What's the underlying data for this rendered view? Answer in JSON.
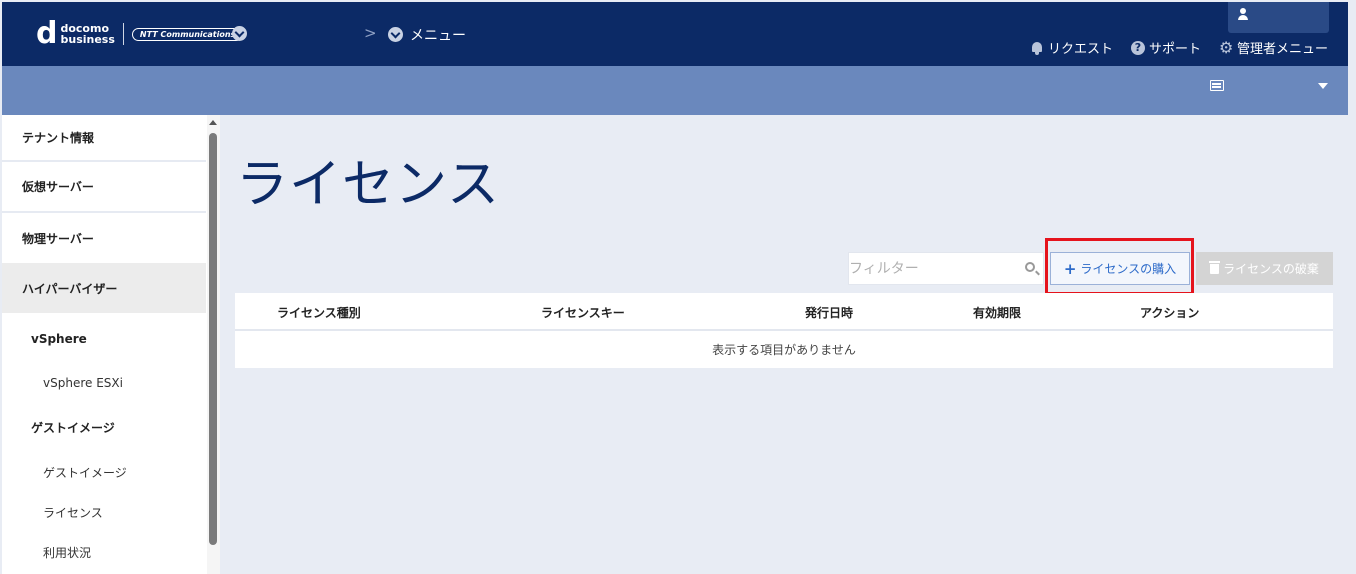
{
  "header": {
    "logo_d": "d",
    "logo_line1": "docomo",
    "logo_line2": "business",
    "logo_ntt": "NTT Communications",
    "breadcrumb_arrow": ">",
    "menu_label": "メニュー",
    "links": {
      "request": "リクエスト",
      "support": "サポート",
      "admin_menu": "管理者メニュー"
    }
  },
  "sidebar": {
    "tenant_info": "テナント情報",
    "virtual_server": "仮想サーバー",
    "physical_server": "物理サーバー",
    "hypervisor": "ハイパーバイザー",
    "vsphere": "vSphere",
    "vsphere_esxi": "vSphere ESXi",
    "guest_image_group": "ゲストイメージ",
    "guest_image": "ゲストイメージ",
    "license": "ライセンス",
    "usage": "利用状況"
  },
  "main": {
    "title": "ライセンス",
    "filter_placeholder": "フィルター",
    "buy_button": "ライセンスの購入",
    "discard_button": "ライセンスの破棄",
    "columns": [
      "ライセンス種別",
      "ライセンスキー",
      "発行日時",
      "有効期限",
      "アクション"
    ],
    "empty_message": "表示する項目がありません"
  },
  "colors": {
    "header_bg": "#0c2a66",
    "subheader_bg": "#6a88bd",
    "highlight": "#e5131c",
    "accent": "#2e6bc9"
  }
}
